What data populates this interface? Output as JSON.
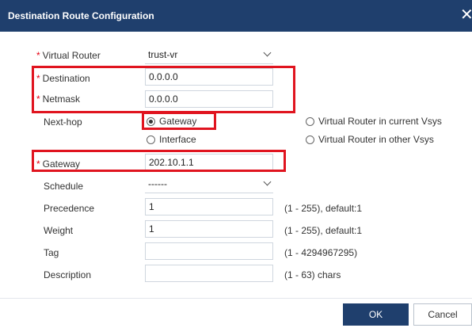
{
  "dialog": {
    "title": "Destination Route Configuration",
    "close_symbol": "✕",
    "accent_color": "#1f3f6d",
    "highlight_color": "#e0141f"
  },
  "form": {
    "virtual_router": {
      "label": "Virtual Router",
      "value": "trust-vr",
      "required": true
    },
    "destination": {
      "label": "Destination",
      "value": "0.0.0.0",
      "required": true
    },
    "netmask": {
      "label": "Netmask",
      "value": "0.0.0.0",
      "required": true
    },
    "next_hop": {
      "label": "Next-hop",
      "options": [
        "Gateway",
        "Interface",
        "Virtual Router in current Vsys",
        "Virtual Router in other Vsys"
      ],
      "selected": "Gateway"
    },
    "gateway": {
      "label": "Gateway",
      "value": "202.10.1.1",
      "required": true
    },
    "schedule": {
      "label": "Schedule",
      "value": "------"
    },
    "precedence": {
      "label": "Precedence",
      "value": "1",
      "hint": "(1 - 255),  default:1"
    },
    "weight": {
      "label": "Weight",
      "value": "1",
      "hint": "(1 - 255),  default:1"
    },
    "tag": {
      "label": "Tag",
      "value": "",
      "hint": "(1 - 4294967295)"
    },
    "description": {
      "label": "Description",
      "value": "",
      "hint": "(1 - 63) chars"
    }
  },
  "buttons": {
    "ok": "OK",
    "cancel": "Cancel"
  }
}
